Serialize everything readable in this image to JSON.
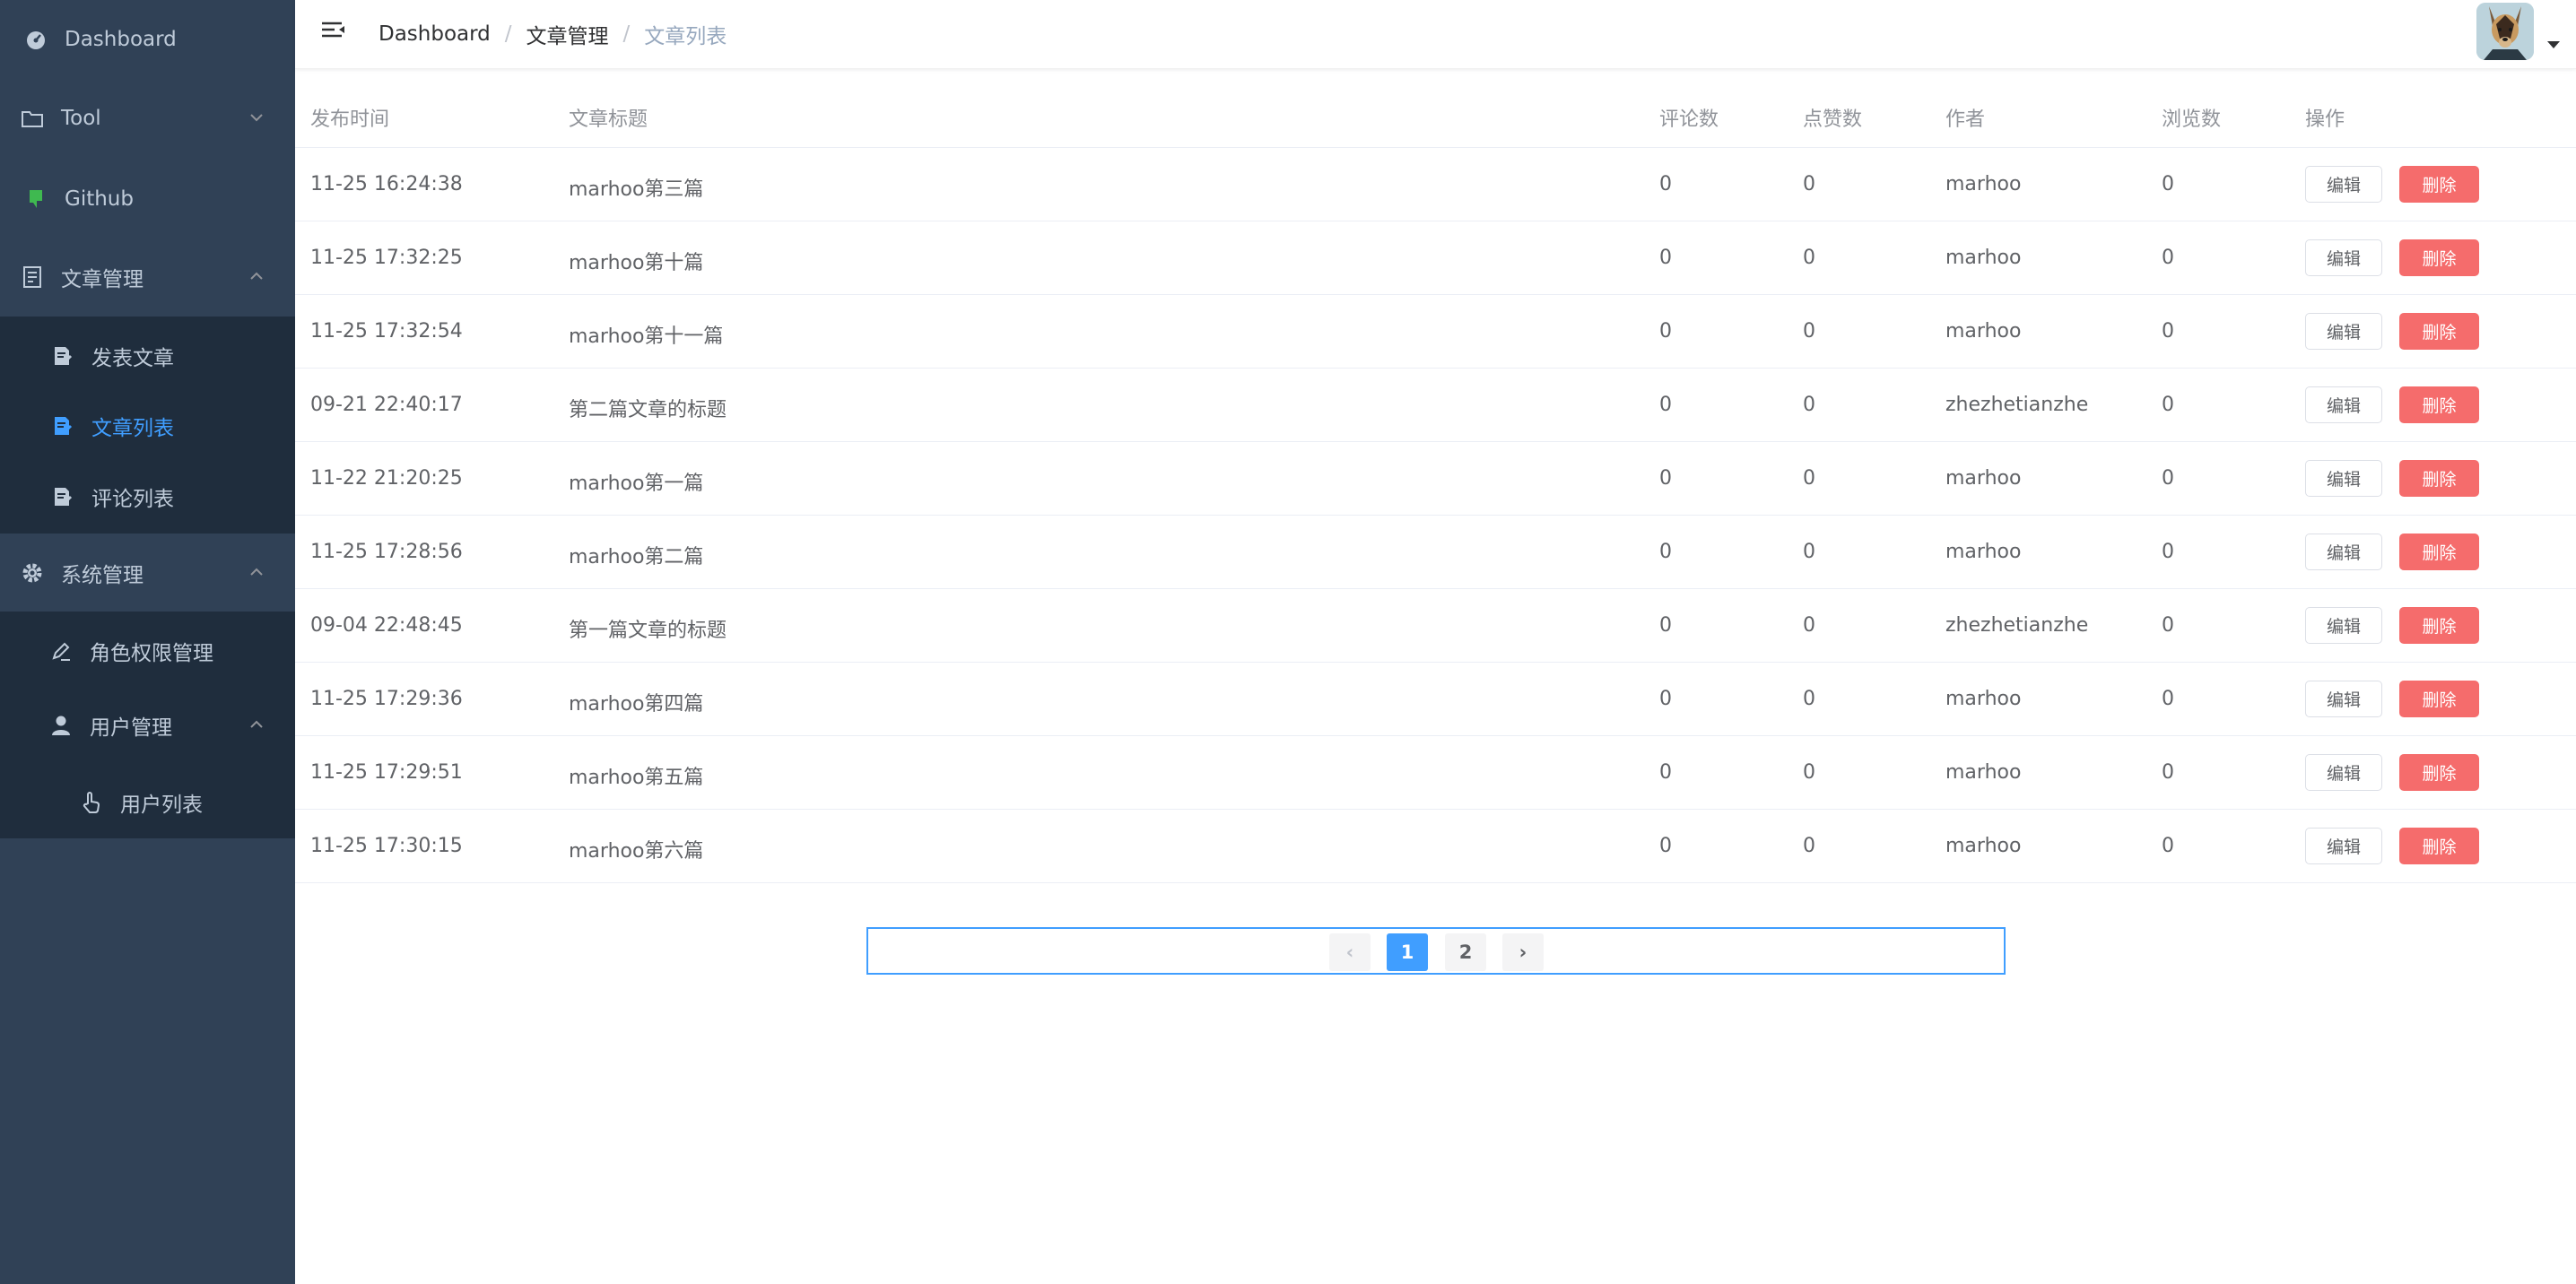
{
  "sidebar": {
    "items": [
      {
        "label": "Dashboard",
        "icon": "dashboard-icon"
      },
      {
        "label": "Tool",
        "icon": "folder-icon"
      },
      {
        "label": "Github",
        "icon": "github-icon"
      },
      {
        "label": "文章管理",
        "icon": "document-icon"
      },
      {
        "label": "发表文章",
        "icon": "edit-doc-icon"
      },
      {
        "label": "文章列表",
        "icon": "edit-doc-icon"
      },
      {
        "label": "评论列表",
        "icon": "edit-doc-icon"
      },
      {
        "label": "系统管理",
        "icon": "gear-icon"
      },
      {
        "label": "角色权限管理",
        "icon": "pen-icon"
      },
      {
        "label": "用户管理",
        "icon": "user-icon"
      },
      {
        "label": "用户列表",
        "icon": "hand-pointer-icon"
      }
    ],
    "active": "文章列表"
  },
  "header": {
    "breadcrumb": [
      "Dashboard",
      "文章管理",
      "文章列表"
    ],
    "separator": "/"
  },
  "table": {
    "columns": [
      "发布时间",
      "文章标题",
      "评论数",
      "点赞数",
      "作者",
      "浏览数",
      "操作"
    ],
    "edit_label": "编辑",
    "delete_label": "删除",
    "rows": [
      [
        "11-25 16:24:38",
        "marhoo第三篇",
        "0",
        "0",
        "marhoo",
        "0"
      ],
      [
        "11-25 17:32:25",
        "marhoo第十篇",
        "0",
        "0",
        "marhoo",
        "0"
      ],
      [
        "11-25 17:32:54",
        "marhoo第十一篇",
        "0",
        "0",
        "marhoo",
        "0"
      ],
      [
        "09-21 22:40:17",
        "第二篇文章的标题",
        "0",
        "0",
        "zhezhetianzhe",
        "0"
      ],
      [
        "11-22 21:20:25",
        "marhoo第一篇",
        "0",
        "0",
        "marhoo",
        "0"
      ],
      [
        "11-25 17:28:56",
        "marhoo第二篇",
        "0",
        "0",
        "marhoo",
        "0"
      ],
      [
        "09-04 22:48:45",
        "第一篇文章的标题",
        "0",
        "0",
        "zhezhetianzhe",
        "0"
      ],
      [
        "11-25 17:29:36",
        "marhoo第四篇",
        "0",
        "0",
        "marhoo",
        "0"
      ],
      [
        "11-25 17:29:51",
        "marhoo第五篇",
        "0",
        "0",
        "marhoo",
        "0"
      ],
      [
        "11-25 17:30:15",
        "marhoo第六篇",
        "0",
        "0",
        "marhoo",
        "0"
      ]
    ]
  },
  "pagination": {
    "pages": [
      "1",
      "2"
    ],
    "current": "1",
    "prev": "‹",
    "next": "›"
  },
  "colors": {
    "sidebar_bg": "#304156",
    "submenu_bg": "#1f2d3d",
    "accent": "#409eff",
    "danger": "#f56c6c"
  }
}
